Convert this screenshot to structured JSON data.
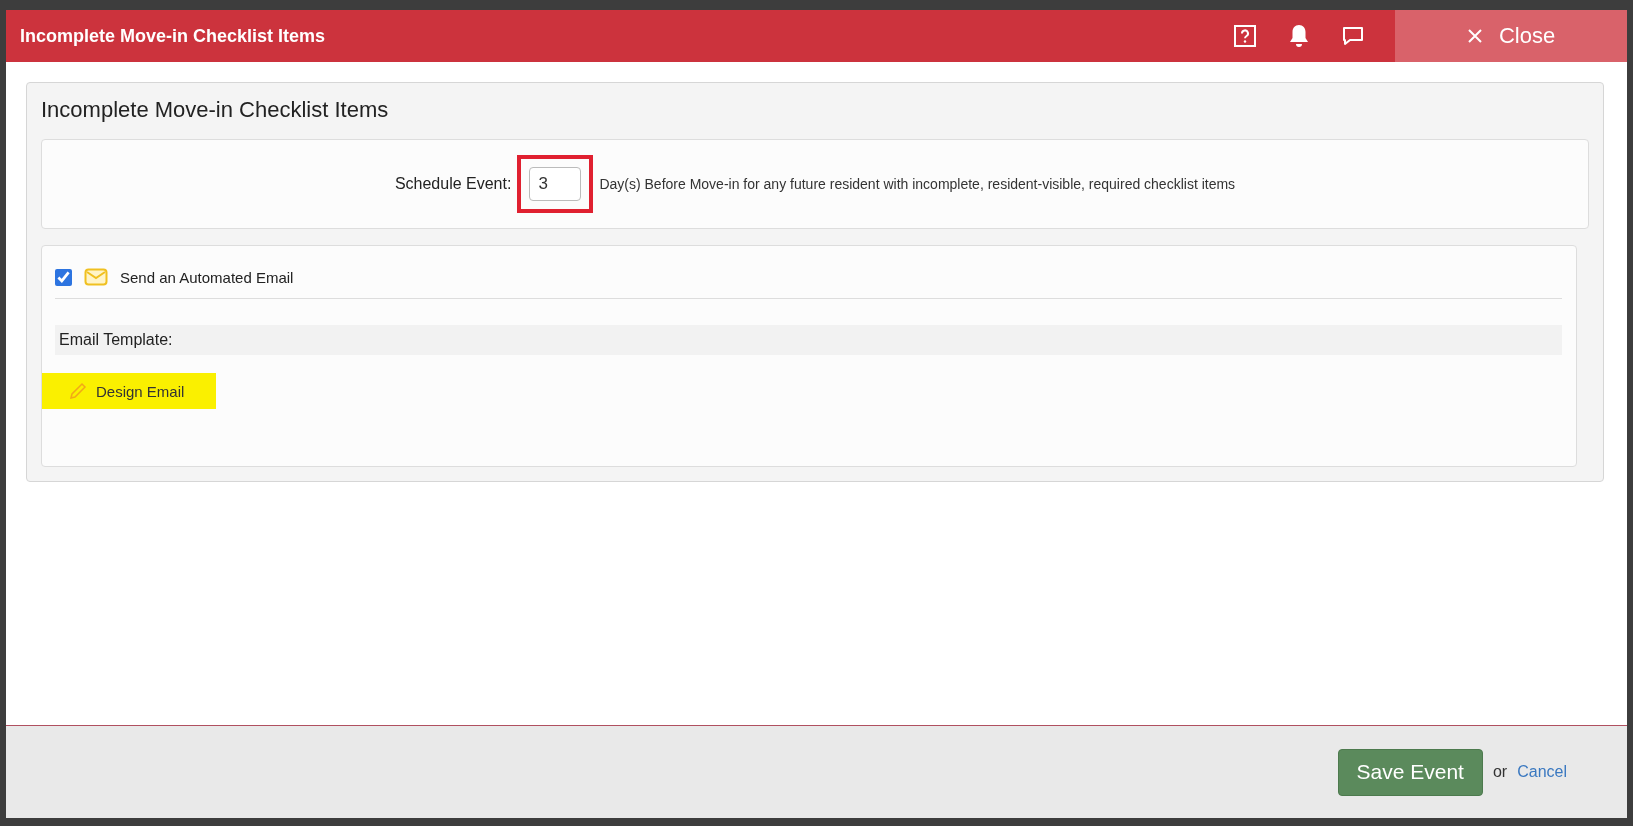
{
  "window": {
    "title": "Incomplete Move-in Checklist Items",
    "close_label": "Close"
  },
  "panel": {
    "heading": "Incomplete Move-in Checklist Items"
  },
  "schedule": {
    "label": "Schedule Event:",
    "days_value": "3",
    "description": "Day(s) Before Move-in for any future resident with incomplete, resident-visible, required checklist items"
  },
  "email": {
    "checked": true,
    "label": "Send an Automated Email",
    "template_label": "Email Template:",
    "design_button": "Design Email"
  },
  "footer": {
    "save_button": "Save Event",
    "or_text": "or",
    "cancel_link": "Cancel"
  }
}
